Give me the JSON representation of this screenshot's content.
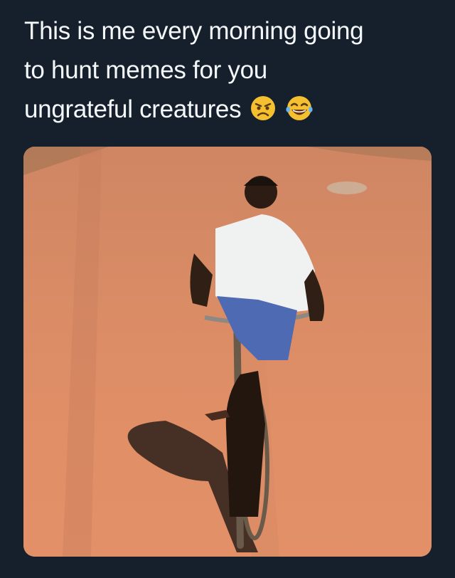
{
  "tweet": {
    "text_lines": [
      "This is me every morning going",
      "to hunt memes for you",
      "ungrateful creatures"
    ],
    "emojis": [
      "angry-face-emoji",
      "tears-of-joy-emoji"
    ]
  },
  "media": {
    "subject": "man-riding-bicycle-photo",
    "colors": {
      "background": "#16202c",
      "road": "#d98a62",
      "text": "#f5f8fa"
    }
  }
}
